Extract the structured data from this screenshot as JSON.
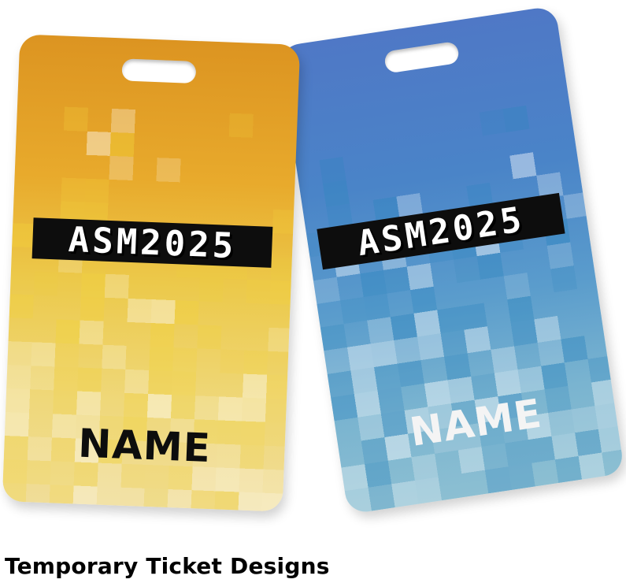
{
  "page": {
    "title": "Temporary Ticket Designs"
  },
  "cards": [
    {
      "id": "yellow",
      "event_label": "ASM2025",
      "name_label": "NAME",
      "colors": {
        "top": "#dc9421",
        "bottom": "#f0dd98",
        "pixel": "#f2d23c",
        "name_text": "#0d0d0d"
      }
    },
    {
      "id": "blue",
      "event_label": "ASM2025",
      "name_label": "NAME",
      "colors": {
        "top": "#4f78c6",
        "bottom": "#8cbfd2",
        "pixel": "#2f86bf",
        "name_text": "#f4f4f4"
      }
    }
  ]
}
